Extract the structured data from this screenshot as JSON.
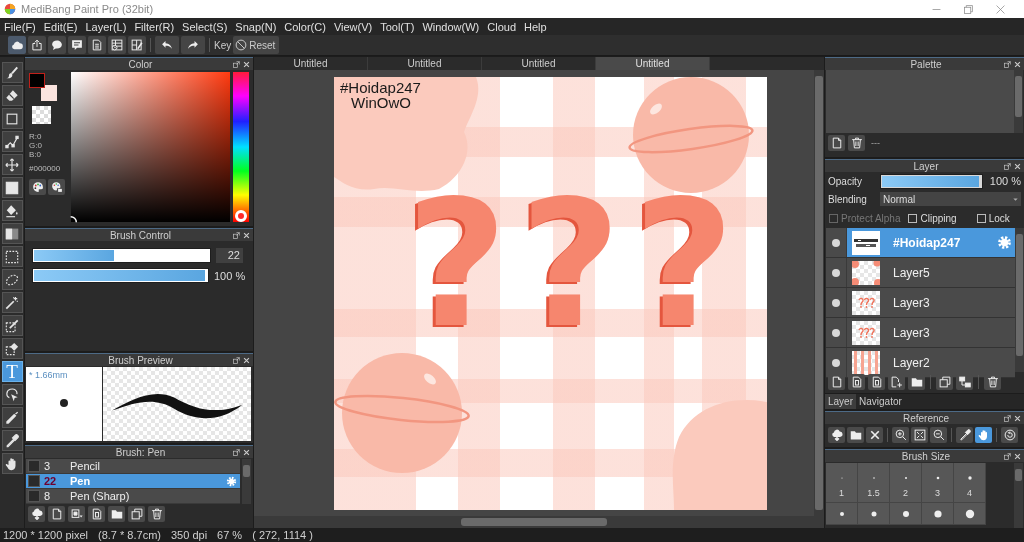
{
  "window": {
    "title": "MediBang Paint Pro (32bit)"
  },
  "menu": [
    "File(F)",
    "Edit(E)",
    "Layer(L)",
    "Filter(R)",
    "Select(S)",
    "Snap(N)",
    "Color(C)",
    "View(V)",
    "Tool(T)",
    "Window(W)",
    "Cloud",
    "Help"
  ],
  "toolbar": {
    "key_label": "Key",
    "reset_button": "Reset"
  },
  "tools": [
    {
      "selected": false
    },
    {
      "selected": false
    },
    {
      "selected": false
    },
    {
      "selected": false
    },
    {
      "selected": false
    },
    {
      "selected": false
    },
    {
      "selected": false
    },
    {
      "selected": false
    },
    {
      "selected": false
    },
    {
      "selected": false
    },
    {
      "selected": false
    },
    {
      "selected": false
    },
    {
      "selected": false
    },
    {
      "glyph": "T",
      "selected": true
    },
    {
      "selected": false
    },
    {
      "selected": false
    },
    {
      "selected": false
    },
    {
      "selected": false
    }
  ],
  "color_panel": {
    "title": "Color",
    "swatches": [
      {
        "kind": "foreground",
        "color": "#000000"
      },
      {
        "kind": "background",
        "color": "#fbe4df"
      },
      {
        "kind": "transparent"
      }
    ],
    "readouts": [
      "R:0",
      "G:0",
      "B:0"
    ],
    "hex": "#000000",
    "hue_slider": {
      "level": 0
    }
  },
  "brush_control": {
    "title": "Brush Control",
    "size": {
      "level": 0.46,
      "value": "22"
    },
    "opacity": {
      "level": 1,
      "reading": "100 %"
    }
  },
  "brush_preview": {
    "title": "Brush Preview",
    "tip_size": "* 1.66mm"
  },
  "brush_list": {
    "title": "Brush: Pen",
    "brushes": [
      {
        "size": "3",
        "name": "Pencil",
        "selected": false
      },
      {
        "size": "22",
        "name": "Pen",
        "selected": true
      },
      {
        "size": "8",
        "name": "Pen (Sharp)",
        "selected": false
      }
    ]
  },
  "canvas": {
    "tabs": [
      {
        "label": "Untitled",
        "selected": false
      },
      {
        "label": "Untitled",
        "selected": false
      },
      {
        "label": "Untitled",
        "selected": false
      },
      {
        "label": "Untitled",
        "selected": true
      }
    ],
    "texts": [
      "#Hoidap247",
      "WinOwO"
    ],
    "glyphs": [
      "?",
      "?",
      "?"
    ]
  },
  "status_bar": [
    "1200 * 1200 pixel",
    "(8.7 * 8.7cm)",
    "350 dpi",
    "67 %",
    "( 272, 1114 )"
  ],
  "palette": {
    "title": "Palette",
    "label": "---"
  },
  "layer_panel": {
    "title": "Layer",
    "opacity_label": "Opacity",
    "opacity": {
      "level": 1,
      "reading": "100 %"
    },
    "blending_label": "Blending",
    "blending": "Normal",
    "options": [
      {
        "label": "Protect Alpha",
        "checked": false,
        "disabled": true
      },
      {
        "label": "Clipping",
        "checked": false,
        "disabled": false
      },
      {
        "label": "Lock",
        "checked": false,
        "disabled": false
      }
    ],
    "layers": [
      {
        "name": "#Hoidap247",
        "kind": "text",
        "visible": true,
        "selected": true
      },
      {
        "name": "Layer5",
        "kind": "dots",
        "visible": true,
        "selected": false
      },
      {
        "name": "Layer3",
        "kind": "marks",
        "visible": true,
        "selected": false
      },
      {
        "name": "Layer3",
        "kind": "marks",
        "visible": true,
        "selected": false
      },
      {
        "name": "Layer2",
        "kind": "stripes",
        "visible": true,
        "selected": false
      }
    ]
  },
  "dock_tabs": [
    {
      "label": "Layer",
      "selected": true
    },
    {
      "label": "Navigator",
      "selected": false
    }
  ],
  "reference": {
    "title": "Reference",
    "tools": [
      {
        "selected": false
      },
      {
        "selected": false
      },
      {
        "selected": false
      },
      {
        "selected": false
      },
      {
        "selected": false
      },
      {
        "selected": false
      },
      {
        "selected": false
      },
      {
        "selected": true
      },
      {
        "selected": false
      }
    ]
  },
  "brush_size": {
    "title": "Brush Size",
    "sizes": [
      "1",
      "1.5",
      "2",
      "3",
      "4"
    ]
  }
}
